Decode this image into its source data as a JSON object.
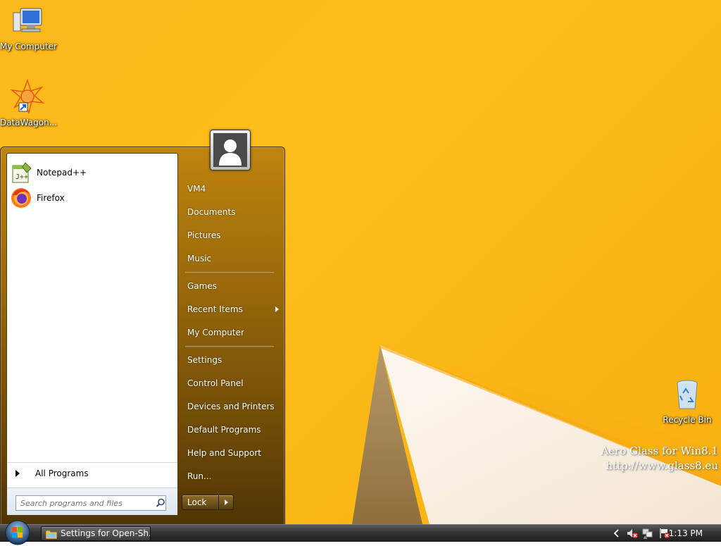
{
  "desktop": {
    "icons": [
      {
        "label": "My Computer",
        "icon": "computer-icon"
      },
      {
        "label": "DataWagon...",
        "icon": "datawagon-icon"
      },
      {
        "label": "Recycle Bin",
        "icon": "recycle-bin-icon"
      }
    ],
    "watermark": {
      "line1": "Aero Glass for Win8.1",
      "line2": "http://www.glass8.eu"
    }
  },
  "start_menu": {
    "pinned": [
      {
        "label": "Notepad++",
        "icon": "notepad-plus-plus-icon"
      },
      {
        "label": "Firefox",
        "icon": "firefox-icon"
      }
    ],
    "all_programs_label": "All Programs",
    "search_placeholder": "Search programs and files",
    "right_items": [
      {
        "label": "VM4"
      },
      {
        "label": "Documents"
      },
      {
        "label": "Pictures"
      },
      {
        "label": "Music"
      },
      {
        "label": "Games"
      },
      {
        "label": "Recent Items",
        "submenu": true
      },
      {
        "label": "My Computer"
      },
      {
        "label": "Settings"
      },
      {
        "label": "Control Panel"
      },
      {
        "label": "Devices and Printers"
      },
      {
        "label": "Default Programs"
      },
      {
        "label": "Help and Support"
      },
      {
        "label": "Run..."
      }
    ],
    "lock_label": "Lock",
    "colors": {
      "menu_accent": "#9b6a0a",
      "desktop_bg": "#fbb81c"
    }
  },
  "taskbar": {
    "task_button_label": "Settings for Open-Sh...",
    "clock": "1:13 PM"
  }
}
